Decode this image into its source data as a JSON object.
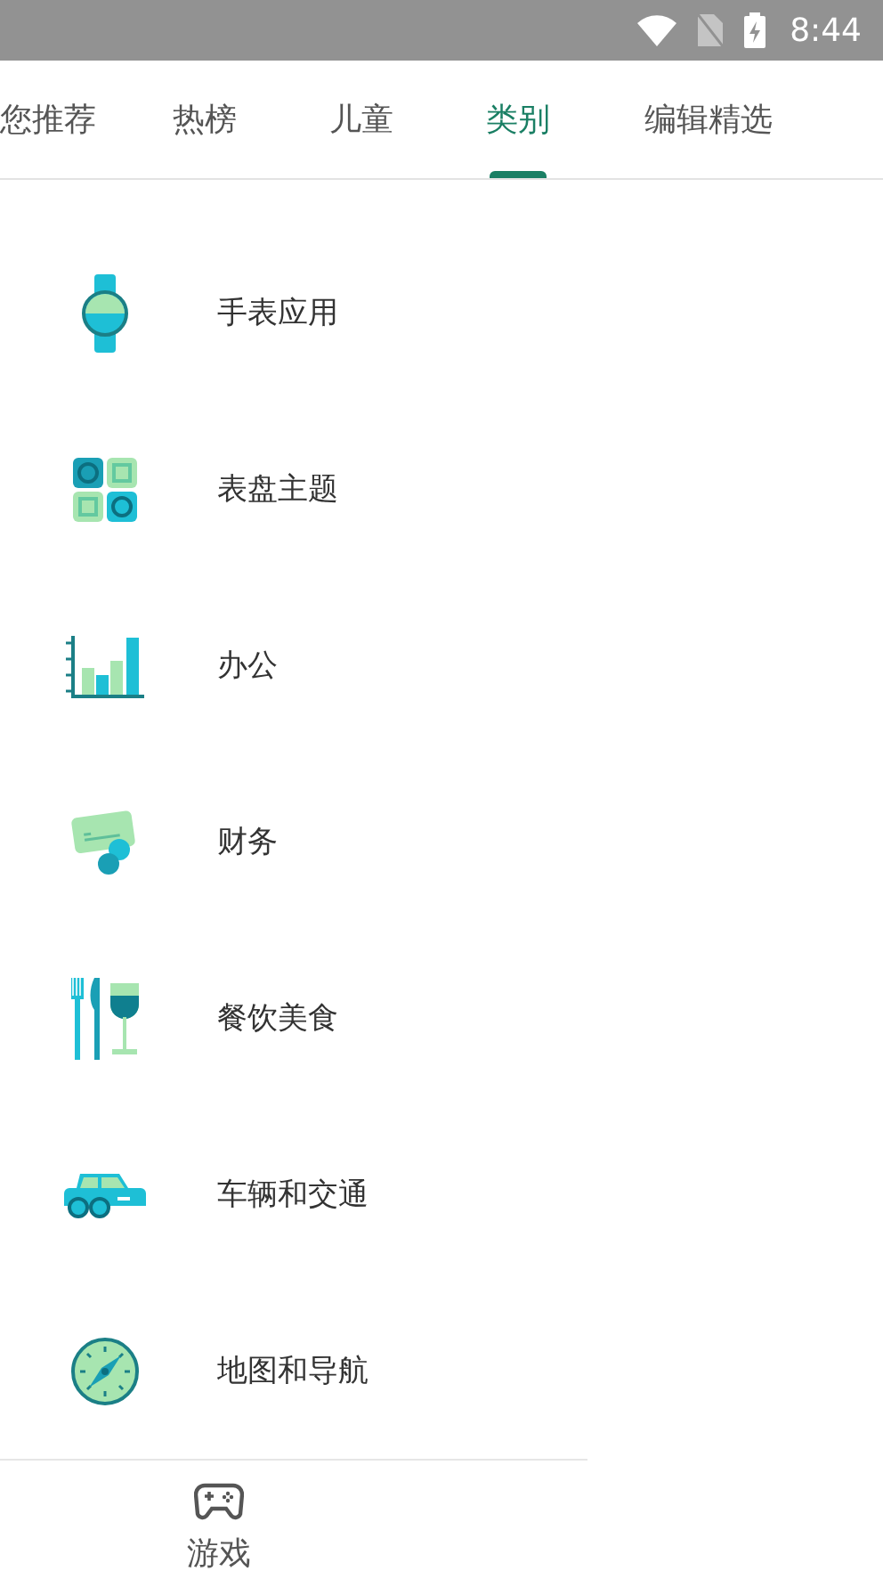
{
  "status_bar": {
    "time": "8:44"
  },
  "tabs": [
    {
      "label": "您推荐",
      "selected": false
    },
    {
      "label": "热榜",
      "selected": false
    },
    {
      "label": "儿童",
      "selected": false
    },
    {
      "label": "类别",
      "selected": true
    },
    {
      "label": "编辑精选",
      "selected": false
    }
  ],
  "categories": [
    {
      "label": "手表应用"
    },
    {
      "label": "表盘主题"
    },
    {
      "label": "办公"
    },
    {
      "label": "财务"
    },
    {
      "label": "餐饮美食"
    },
    {
      "label": "车辆和交通"
    },
    {
      "label": "地图和导航"
    }
  ],
  "bottom_nav": [
    {
      "label": "游戏"
    }
  ]
}
